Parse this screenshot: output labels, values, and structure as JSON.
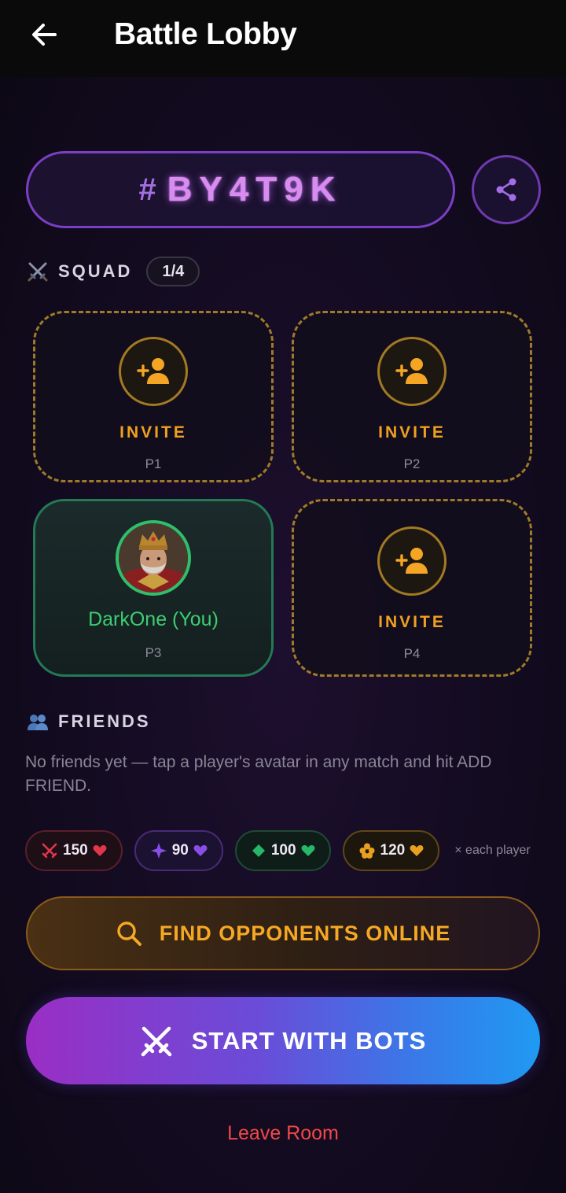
{
  "header": {
    "title": "Battle Lobby",
    "back_icon": "arrow-left-icon"
  },
  "room": {
    "hash": "#",
    "code": "BY4T9K",
    "share_icon": "share-icon"
  },
  "squad": {
    "label": "SQUAD",
    "count": "1/4",
    "icon": "crossed-swords-icon",
    "slots": [
      {
        "status": "empty",
        "action": "INVITE",
        "position": "P1"
      },
      {
        "status": "empty",
        "action": "INVITE",
        "position": "P2"
      },
      {
        "status": "occupied",
        "name": "DarkOne (You)",
        "position": "P3"
      },
      {
        "status": "empty",
        "action": "INVITE",
        "position": "P4"
      }
    ]
  },
  "friends": {
    "label": "FRIENDS",
    "icon": "people-icon",
    "empty_text": "No friends yet — tap a player's avatar in any match and hit ADD FRIEND."
  },
  "entry_fees": {
    "items": [
      {
        "value": "150",
        "icon": "swords-icon",
        "color": "#e2364a"
      },
      {
        "value": "90",
        "icon": "sparkle-icon",
        "color": "#8a4ee8"
      },
      {
        "value": "100",
        "icon": "diamond-icon",
        "color": "#27b768"
      },
      {
        "value": "120",
        "icon": "flower-icon",
        "color": "#e8a020"
      }
    ],
    "note": "× each player"
  },
  "actions": {
    "find_opponents": "FIND OPPONENTS ONLINE",
    "start_bots": "START WITH BOTS",
    "leave_room": "Leave Room"
  },
  "colors": {
    "accent_purple": "#7a3fc4",
    "accent_gold": "#f0a020",
    "accent_green": "#3ccd72",
    "danger": "#f04848"
  }
}
